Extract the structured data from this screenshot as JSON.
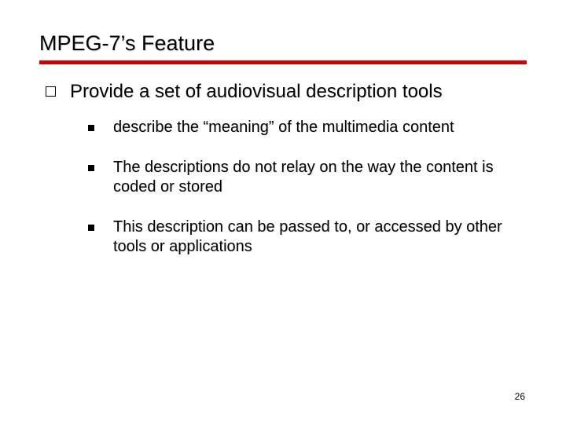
{
  "title": "MPEG-7’s Feature",
  "level1": {
    "text": "Provide a set of audiovisual description tools"
  },
  "level2": [
    {
      "text": "describe the “meaning” of the multimedia content"
    },
    {
      "text": "The descriptions do not relay on the way the content is coded or stored"
    },
    {
      "text": "This description can be passed to, or accessed  by other tools or applications"
    }
  ],
  "page_number": "26"
}
